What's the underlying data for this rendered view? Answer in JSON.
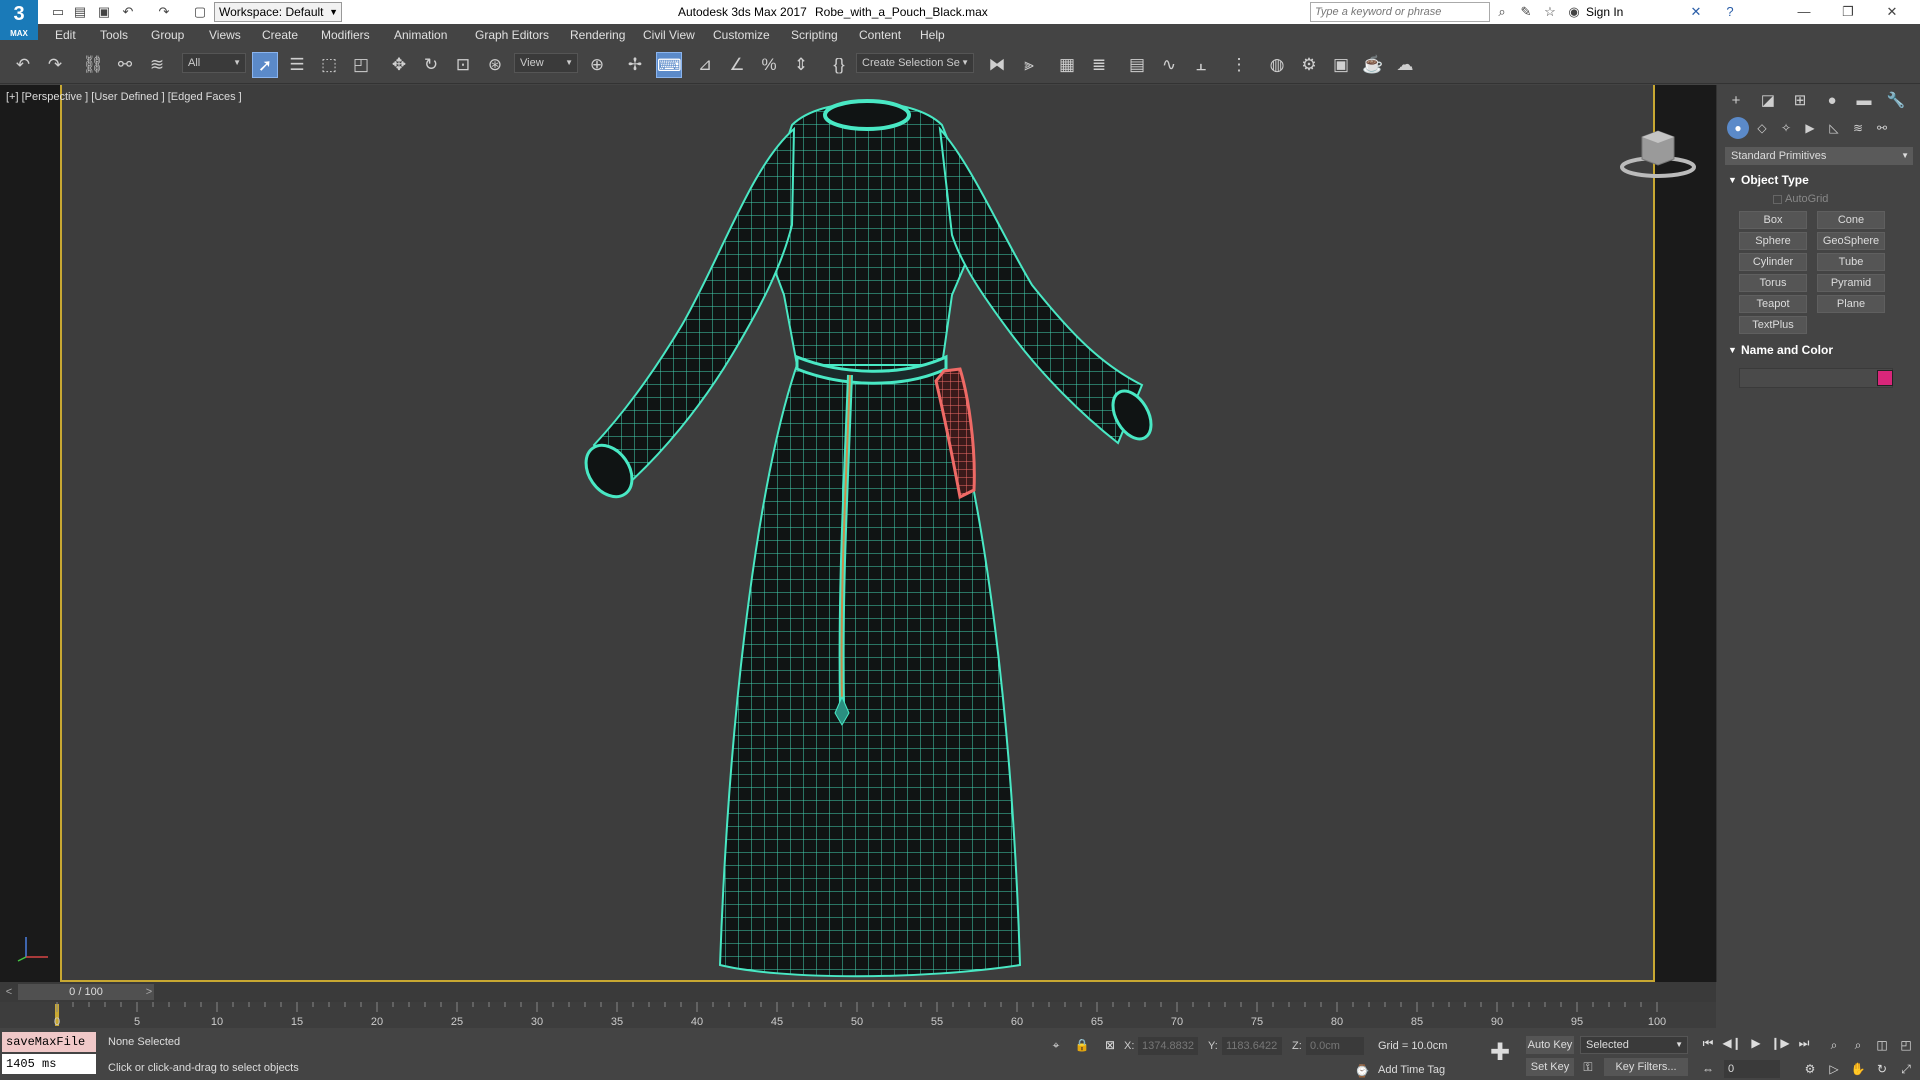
{
  "app": {
    "logo_text": "3",
    "logo_sub": "MAX",
    "workspace": "Workspace: Default",
    "title": "Autodesk 3ds Max 2017",
    "file_name": "Robe_with_a_Pouch_Black.max",
    "search_placeholder": "Type a keyword or phrase",
    "sign_in": "Sign In"
  },
  "menu": [
    "Edit",
    "Tools",
    "Group",
    "Views",
    "Create",
    "Modifiers",
    "Animation",
    "Graph Editors",
    "Rendering",
    "Civil View",
    "Customize",
    "Scripting",
    "Content",
    "Help"
  ],
  "toolbar": {
    "selection_filter": "All",
    "reference_coord": "View",
    "named_selection": "Create Selection Se"
  },
  "viewport": {
    "label": "[+] [Perspective ] [User Defined ] [Edged Faces ]",
    "wireframe_color": "#49e8c4",
    "pouch_color": "#ef6a66",
    "background": "#3d3d3d",
    "active_border": "#c8a832"
  },
  "command_panel": {
    "category": "Standard Primitives",
    "object_type_title": "Object Type",
    "autogrid_label": "AutoGrid",
    "primitives": [
      "Box",
      "Cone",
      "Sphere",
      "GeoSphere",
      "Cylinder",
      "Tube",
      "Torus",
      "Pyramid",
      "Teapot",
      "Plane",
      "TextPlus"
    ],
    "name_color_title": "Name and Color",
    "object_color": "#d8267a"
  },
  "timeline": {
    "position": "0 / 100",
    "frame_current": 0,
    "frame_end": 100,
    "ticks": [
      "0",
      "5",
      "10",
      "15",
      "20",
      "25",
      "30",
      "35",
      "40",
      "45",
      "50",
      "55",
      "60",
      "65",
      "70",
      "75",
      "80",
      "85",
      "90",
      "95",
      "100"
    ]
  },
  "status": {
    "maxscript_line1": "saveMaxFile",
    "maxscript_line2": "1405 ms",
    "selection": "None Selected",
    "prompt": "Click or click-and-drag to select objects",
    "x_label": "X:",
    "x_value": "1374.8832",
    "y_label": "Y:",
    "y_value": "1183.6422",
    "z_label": "Z:",
    "z_value": "0.0cm",
    "grid": "Grid = 10.0cm",
    "add_time_tag": "Add Time Tag",
    "auto_key": "Auto Key",
    "set_key": "Set Key",
    "key_mode": "Selected",
    "key_filters": "Key Filters...",
    "frame_field": "0"
  }
}
